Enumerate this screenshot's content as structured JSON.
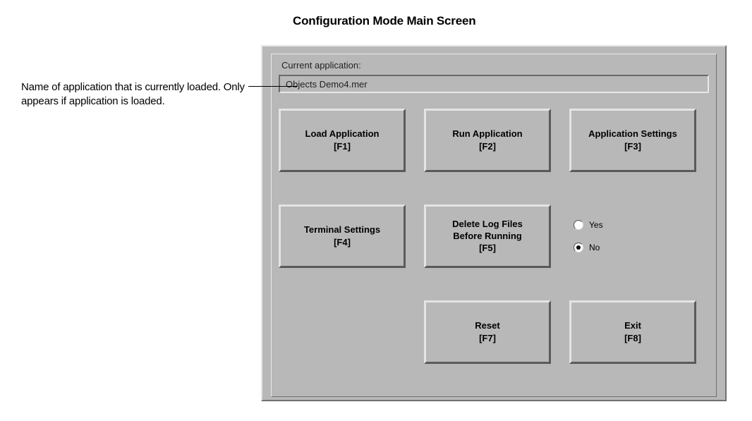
{
  "page_heading": "Configuration Mode Main Screen",
  "annotation": "Name of application that is currently loaded. Only appears if application is loaded.",
  "current_app_label": "Current application:",
  "current_app_value": "Objects Demo4.mer",
  "buttons": {
    "load": {
      "line1": "Load Application",
      "fkey": "[F1]"
    },
    "run": {
      "line1": "Run Application",
      "fkey": "[F2]"
    },
    "appset": {
      "line1": "Application Settings",
      "fkey": "[F3]"
    },
    "termset": {
      "line1": "Terminal Settings",
      "fkey": "[F4]"
    },
    "dellog": {
      "line1": "Delete Log Files",
      "line2": "Before Running",
      "fkey": "[F5]"
    },
    "reset": {
      "line1": "Reset",
      "fkey": "[F7]"
    },
    "exit": {
      "line1": "Exit",
      "fkey": "[F8]"
    }
  },
  "radio": {
    "yes_label": "Yes",
    "no_label": "No",
    "selected": "no"
  }
}
